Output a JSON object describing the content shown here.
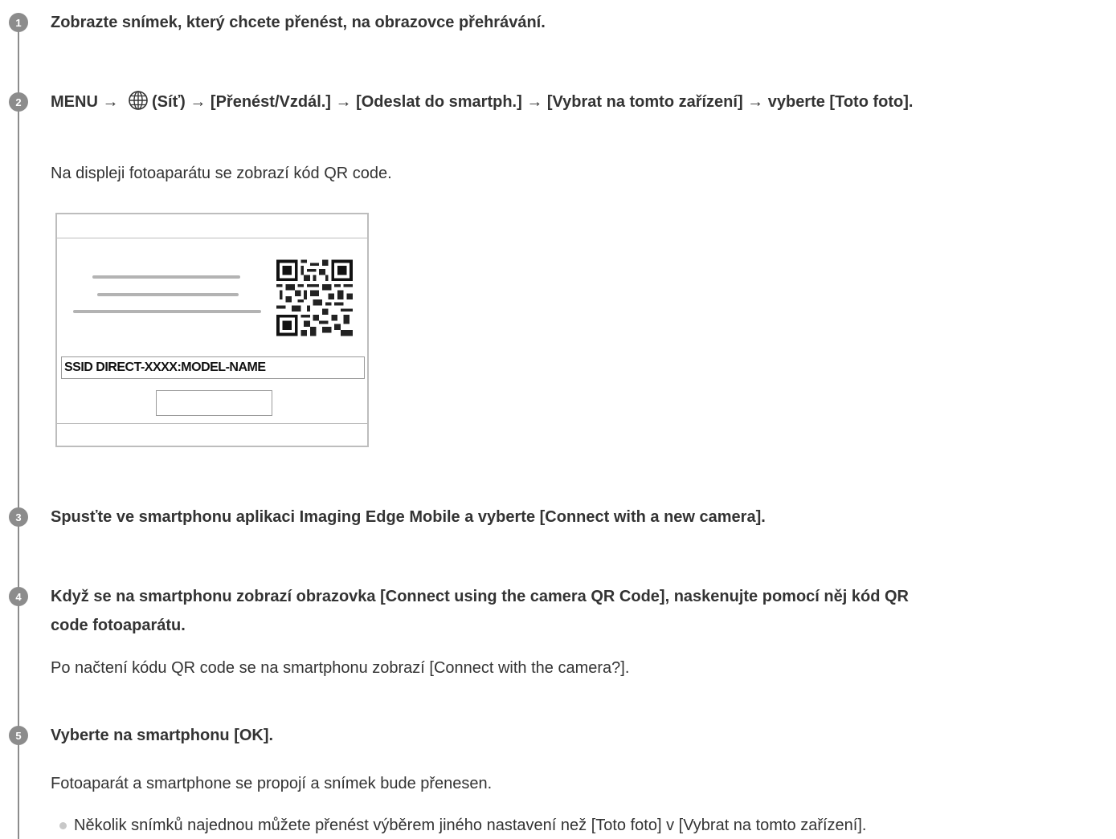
{
  "steps": [
    {
      "number": "1",
      "heading": "Zobrazte snímek, který chcete přenést, na obrazovce přehrávání."
    },
    {
      "number": "2",
      "heading_prefix": "MENU →",
      "heading_suffix": "(Síť) → [Přenést/Vzdál.] → [Odeslat do smartph.] → [Vybrat na tomto zařízení] → vyberte [Toto foto].",
      "description": "Na displeji fotoaparátu se zobrazí kód QR code.",
      "illustration": {
        "ssid_text": "SSID DIRECT-XXXX:MODEL-NAME",
        "icon": "network-globe-icon"
      }
    },
    {
      "number": "3",
      "heading": "Spusťte ve smartphonu aplikaci Imaging Edge Mobile a vyberte [Connect with a new camera]."
    },
    {
      "number": "4",
      "heading": "Když se na smartphonu zobrazí obrazovka [Connect using the camera QR Code], naskenujte pomocí něj kód QR code fotoaparátu.",
      "description": "Po načtení kódu QR code se na smartphonu zobrazí [Connect with the camera?]."
    },
    {
      "number": "5",
      "heading": "Vyberte na smartphonu [OK].",
      "description": "Fotoaparát a smartphone se propojí a snímek bude přenesen.",
      "note": "Několik snímků najednou můžete přenést výběrem jiného nastavení než [Toto foto] v [Vybrat na tomto zařízení]."
    }
  ],
  "colors": {
    "text": "#333333",
    "step_circle": "#8c8c8c",
    "timeline": "#8c8c8c"
  }
}
